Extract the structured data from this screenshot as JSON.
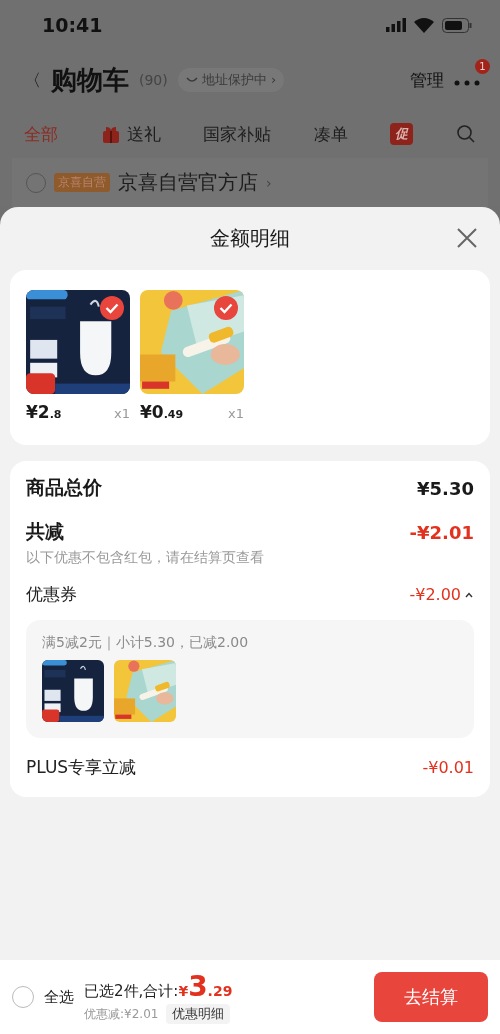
{
  "status_bar": {
    "time": "10:41"
  },
  "nav": {
    "back": "〈",
    "title": "购物车",
    "count": "(90)",
    "address": "地址保护中 ›",
    "manage": "管理",
    "more_badge": "1"
  },
  "tabs": [
    {
      "label": "全部",
      "selected": true,
      "kind": "text"
    },
    {
      "label": "送礼",
      "selected": false,
      "kind": "gift"
    },
    {
      "label": "国家补贴",
      "selected": false,
      "kind": "text"
    },
    {
      "label": "凑单",
      "selected": false,
      "kind": "text"
    },
    {
      "label": "促",
      "selected": false,
      "kind": "badge"
    }
  ],
  "store": {
    "checked": false,
    "tag": "京喜自营",
    "name": "京喜自营官方店",
    "chevron": "›"
  },
  "sheet": {
    "title": "金额明细",
    "products": [
      {
        "kind": "lamp",
        "selected": true,
        "price_int": "¥2",
        "price_dec": ".8",
        "qty": "x1"
      },
      {
        "kind": "glue",
        "selected": true,
        "price_int": "¥0",
        "price_dec": ".49",
        "qty": "x1"
      }
    ],
    "total_label": "商品总价",
    "total_value": "¥5.30",
    "discount_label": "共减",
    "discount_value": "-¥2.01",
    "discount_note": "以下优惠不包含红包，请在结算页查看",
    "coupon": {
      "label": "优惠券",
      "value": "-¥2.00",
      "expanded": true,
      "rule": "满5减2元｜小计5.30，已减2.00",
      "thumbs": [
        {
          "kind": "lamp"
        },
        {
          "kind": "glue"
        }
      ]
    },
    "plus_label": "PLUS专享立减",
    "plus_value": "-¥0.01"
  },
  "footer": {
    "select_all_checked": false,
    "select_all": "全选",
    "summary": "已选2件,合计:",
    "currency": "¥",
    "total_int": "3",
    "total_dec": ".29",
    "saved": "优惠减:¥2.01",
    "detail_button": "优惠明细",
    "checkout": "去结算"
  }
}
